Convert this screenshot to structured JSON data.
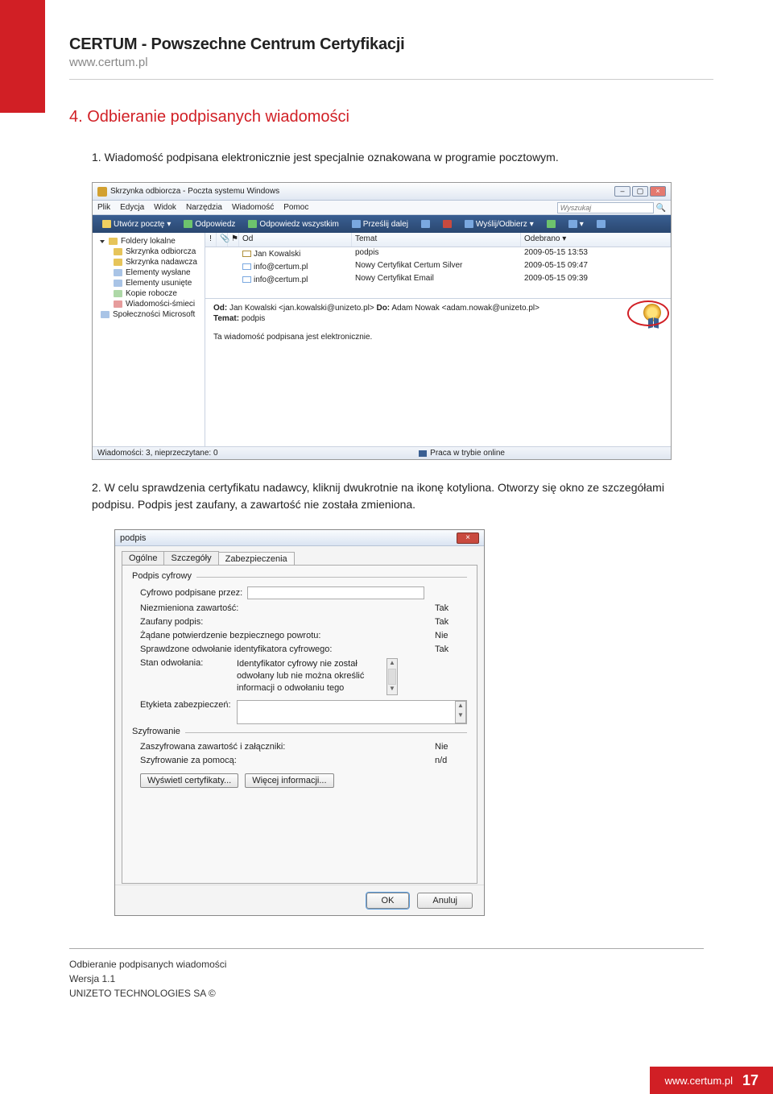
{
  "header": {
    "title": "CERTUM - Powszechne Centrum Certyfikacji",
    "subtitle": "www.certum.pl"
  },
  "heading4": "4.  Odbieranie podpisanych wiadomości",
  "step1": "1. Wiadomość podpisana elektronicznie jest specjalnie oznakowana w programie pocztowym.",
  "step2": "2. W celu sprawdzenia certyfikatu nadawcy, kliknij dwukrotnie na ikonę kotyliona. Otworzy się okno ze szczegółami podpisu. Podpis jest zaufany, a zawartość nie została zmieniona.",
  "mail": {
    "windowTitle": "Skrzynka odbiorcza - Poczta systemu Windows",
    "menus": [
      "Plik",
      "Edycja",
      "Widok",
      "Narzędzia",
      "Wiadomość",
      "Pomoc"
    ],
    "searchPlaceholder": "Wyszukaj",
    "toolbar": {
      "create": "Utwórz pocztę",
      "reply": "Odpowiedz",
      "replyAll": "Odpowiedz wszystkim",
      "forward": "Prześlij dalej",
      "sendrecv": "Wyślij/Odbierz"
    },
    "tree": {
      "root": "Foldery lokalne",
      "items": [
        "Skrzynka odbiorcza",
        "Skrzynka nadawcza",
        "Elementy wysłane",
        "Elementy usunięte",
        "Kopie robocze",
        "Wiadomości-śmieci"
      ],
      "community": "Społeczności Microsoft"
    },
    "columns": {
      "from": "Od",
      "subject": "Temat",
      "received": "Odebrano"
    },
    "rows": [
      {
        "from": "Jan Kowalski",
        "subject": "podpis",
        "received": "2009-05-15 13:53"
      },
      {
        "from": "info@certum.pl",
        "subject": "Nowy Certyfikat Certum Silver",
        "received": "2009-05-15 09:47"
      },
      {
        "from": "info@certum.pl",
        "subject": "Nowy Certyfikat Email",
        "received": "2009-05-15 09:39"
      }
    ],
    "preview": {
      "fromLabel": "Od:",
      "fromValue": "Jan Kowalski <jan.kowalski@unizeto.pl>",
      "toLabel": "Do:",
      "toValue": "Adam Nowak <adam.nowak@unizeto.pl>",
      "subjectLabel": "Temat:",
      "subjectValue": "podpis",
      "body": "Ta wiadomość podpisana jest elektronicznie."
    },
    "status": {
      "left": "Wiadomości: 3, nieprzeczytane: 0",
      "right": "Praca w trybie online"
    }
  },
  "dialog": {
    "title": "podpis",
    "tabs": [
      "Ogólne",
      "Szczegóły",
      "Zabezpieczenia"
    ],
    "activeTab": 2,
    "group1": {
      "legend": "Podpis cyfrowy",
      "signedBy": "Cyfrowo podpisane przez:",
      "lines": [
        {
          "label": "Niezmieniona zawartość:",
          "value": "Tak"
        },
        {
          "label": "Zaufany podpis:",
          "value": "Tak"
        },
        {
          "label": "Żądane potwierdzenie bezpiecznego powrotu:",
          "value": "Nie"
        },
        {
          "label": "Sprawdzone odwołanie identyfikatora cyfrowego:",
          "value": "Tak"
        }
      ],
      "revocLabel": "Stan odwołania:",
      "revocText": "Identyfikator cyfrowy nie został odwołany lub nie można określić informacji o odwołaniu tego",
      "etiqLabel": "Etykieta zabezpieczeń:"
    },
    "group2": {
      "legend": "Szyfrowanie",
      "lines": [
        {
          "label": "Zaszyfrowana zawartość i załączniki:",
          "value": "Nie"
        },
        {
          "label": "Szyfrowanie za pomocą:",
          "value": "n/d"
        }
      ]
    },
    "buttons": {
      "showCerts": "Wyświetl certyfikaty...",
      "moreInfo": "Więcej informacji..."
    },
    "footer": {
      "ok": "OK",
      "cancel": "Anuluj"
    }
  },
  "footer": {
    "line1": "Odbieranie podpisanych wiadomości",
    "line2": "Wersja 1.1",
    "line3": "UNIZETO TECHNOLOGIES SA ©",
    "url": "www.certum.pl",
    "page": "17"
  }
}
